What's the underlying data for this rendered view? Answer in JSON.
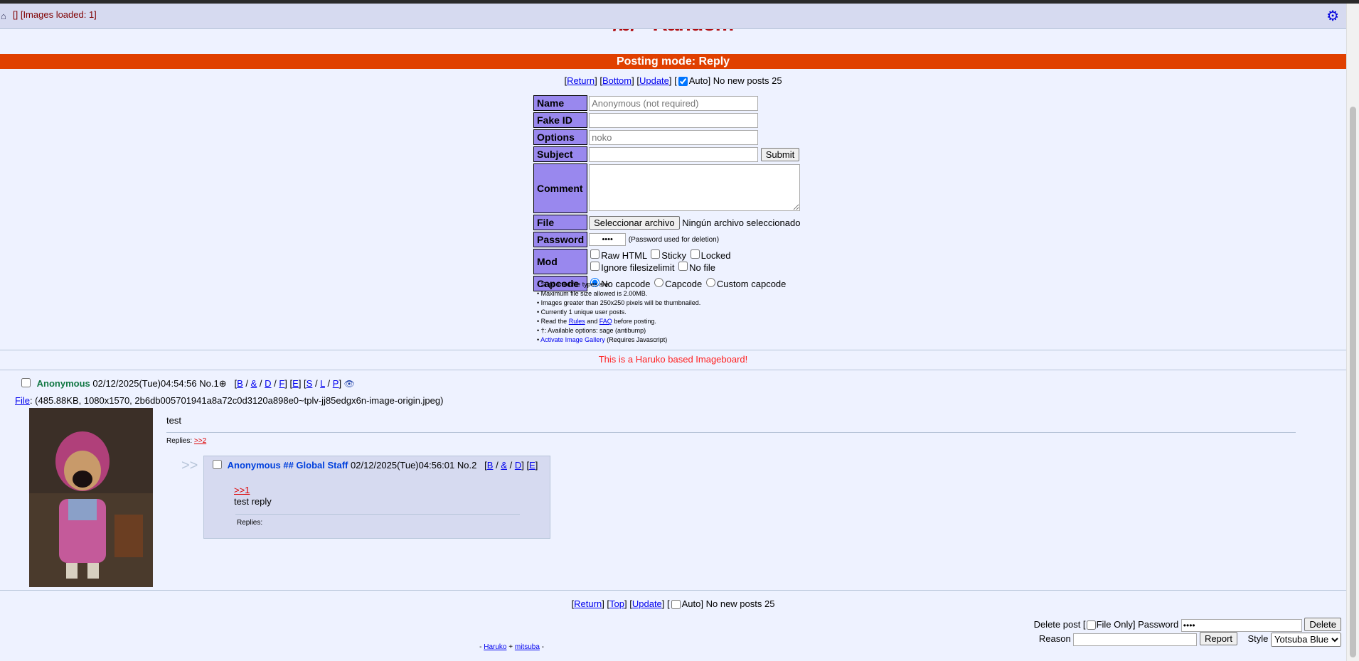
{
  "topbar": {
    "images_loaded": "[] [Images loaded: 1]"
  },
  "board": {
    "title": "/b/ - Random",
    "posting_mode": "Posting mode: Reply"
  },
  "nav_top": {
    "return": "Return",
    "bottom": "Bottom",
    "update": "Update",
    "auto": "Auto]",
    "status": "No new posts 25"
  },
  "form": {
    "name_label": "Name",
    "name_placeholder": "Anonymous (not required)",
    "fakeid_label": "Fake ID",
    "options_label": "Options",
    "options_placeholder": "noko",
    "subject_label": "Subject",
    "submit": "Submit",
    "comment_label": "Comment",
    "file_label": "File",
    "file_button": "Seleccionar archivo",
    "file_status": "Ningún archivo seleccionado",
    "password_label": "Password",
    "password_value": "••••",
    "password_note": "(Password used for deletion)",
    "mod_label": "Mod",
    "mod_raw_html": "Raw HTML",
    "mod_sticky": "Sticky",
    "mod_locked": "Locked",
    "mod_ignore": "Ignore filesizelimit",
    "mod_nofile": "No file",
    "capcode_label": "Capcode",
    "capcode_none": "No capcode",
    "capcode_capcode": "Capcode",
    "capcode_custom": "Custom capcode"
  },
  "rules": {
    "r1": "• Supported file types are:",
    "r2": "• Maximum file size allowed is 2.00MB.",
    "r3": "• Images greater than 250x250 pixels will be thumbnailed.",
    "r4": "• Currently 1 unique user posts.",
    "r5_pre": "• Read the",
    "r5_rules": "Rules",
    "r5_and": "and",
    "r5_faq": "FAQ",
    "r5_post": "before posting.",
    "r6": "• †: Available options: sage (antibump)",
    "r7_link": "Activate Image Gallery",
    "r7_note": "(Requires Javascript)"
  },
  "motd": "This is a Haruko based Imageboard!",
  "op": {
    "name": "Anonymous",
    "date": "02/12/2025(Tue)04:54:56",
    "no": "No.1",
    "links": [
      "B",
      "&",
      "D",
      "F",
      "E",
      "S",
      "L",
      "P"
    ],
    "file_label": "File",
    "file_info": ": (485.88KB, 1080x1570, 2b6db005701941a8a72c0d3120a898e0~tplv-jj85edgx6n-image-origin.jpeg)",
    "text": "test",
    "replies_label": "Replies:",
    "replies_link": ">>2"
  },
  "reply": {
    "arrows": ">>",
    "name": "Anonymous ## Global Staff",
    "date": "02/12/2025(Tue)04:56:01",
    "no": "No.2",
    "links": [
      "B",
      "&",
      "D",
      "E"
    ],
    "quote": ">>1",
    "text": "test reply",
    "replies_label": "Replies:"
  },
  "nav_bottom": {
    "return": "Return",
    "top": "Top",
    "update": "Update",
    "auto": "Auto]",
    "status": "No new posts 25"
  },
  "delete": {
    "label": "Delete post [",
    "file_only": "File Only]",
    "password_label": "Password",
    "password_value": "••••",
    "delete_button": "Delete",
    "reason_label": "Reason",
    "report_button": "Report",
    "style_label": "Style",
    "style_value": "Yotsuba Blue"
  },
  "footer": {
    "haruko": "Haruko",
    "plus": "+",
    "mitsuba": "mitsuba"
  }
}
